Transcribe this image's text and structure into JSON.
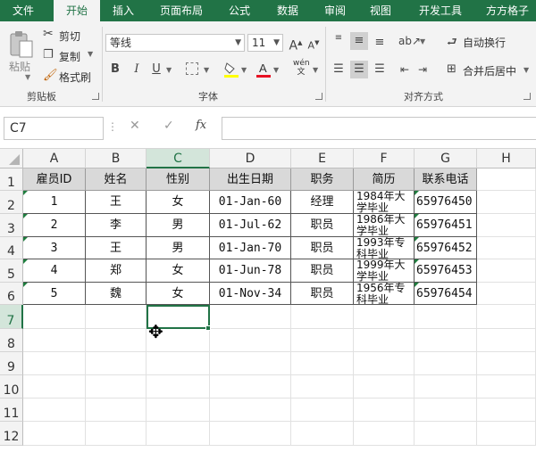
{
  "menu": {
    "items": [
      "文件",
      "开始",
      "插入",
      "页面布局",
      "公式",
      "数据",
      "审阅",
      "视图",
      "开发工具",
      "方方格子"
    ]
  },
  "ribbon": {
    "clipboard": {
      "paste": "粘贴",
      "cut": "剪切",
      "copy": "复制",
      "format_painter": "格式刷",
      "label": "剪贴板"
    },
    "font": {
      "name": "等线",
      "size": "11",
      "bold": "B",
      "italic": "I",
      "underline": "U",
      "grow": "A",
      "shrink": "A",
      "phonetic": "wén",
      "label": "字体"
    },
    "alignment": {
      "wrap_text": "自动换行",
      "merge_center": "合并后居中",
      "label": "对齐方式"
    }
  },
  "formula_bar": {
    "name_box": "C7",
    "cancel": "✕",
    "enter": "✓",
    "fx": "fx",
    "value": ""
  },
  "grid": {
    "columns": [
      "A",
      "B",
      "C",
      "D",
      "E",
      "F",
      "G",
      "H"
    ],
    "rows": [
      "1",
      "2",
      "3",
      "4",
      "5",
      "6",
      "7",
      "8",
      "9",
      "10",
      "11",
      "12"
    ],
    "header": [
      "雇员ID",
      "姓名",
      "性别",
      "出生日期",
      "职务",
      "简历",
      "联系电话"
    ],
    "data": [
      [
        "1",
        "王",
        "女",
        "01-Jan-60",
        "经理",
        "1984年大学毕业",
        "65976450"
      ],
      [
        "2",
        "李",
        "男",
        "01-Jul-62",
        "职员",
        "1986年大学毕业",
        "65976451"
      ],
      [
        "3",
        "王",
        "男",
        "01-Jan-70",
        "职员",
        "1993年专科毕业",
        "65976452"
      ],
      [
        "4",
        "郑",
        "女",
        "01-Jun-78",
        "职员",
        "1999年大学毕业",
        "65976453"
      ],
      [
        "5",
        "魏",
        "女",
        "01-Nov-34",
        "职员",
        "1956年专科毕业",
        "65976454"
      ]
    ],
    "selected_cell": "C7"
  },
  "colors": {
    "excel_green": "#217346",
    "header_fill": "#d9d9d9",
    "font_color_bar": "#e81123",
    "highlight_bar": "#ffff00"
  }
}
